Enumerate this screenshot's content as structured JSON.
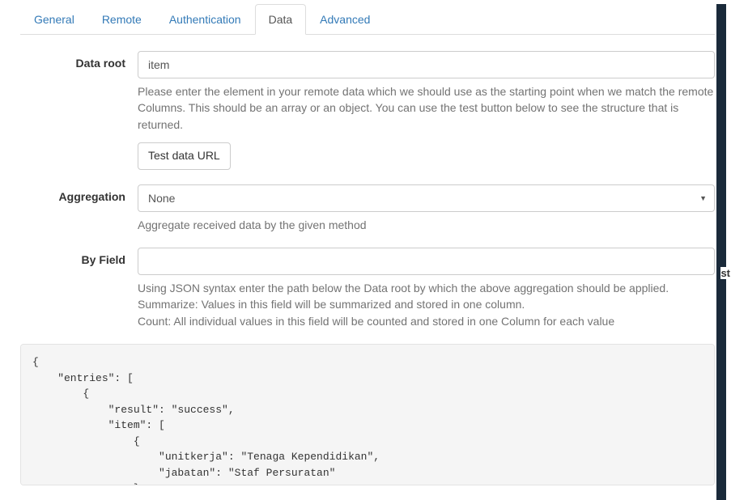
{
  "tabs": {
    "general": "General",
    "remote": "Remote",
    "authentication": "Authentication",
    "data": "Data",
    "advanced": "Advanced"
  },
  "form": {
    "dataRoot": {
      "label": "Data root",
      "value": "item",
      "help": "Please enter the element in your remote data which we should use as the starting point when we match the remote Columns. This should be an array or an object. You can use the test button below to see the structure that is returned.",
      "buttonLabel": "Test data URL"
    },
    "aggregation": {
      "label": "Aggregation",
      "value": "None",
      "help": "Aggregate received data by the given method"
    },
    "byField": {
      "label": "By Field",
      "value": "",
      "help": "Using JSON syntax enter the path below the Data root by which the above aggregation should be applied.\nSummarize: Values in this field will be summarized and stored in one column.\nCount: All individual values in this field will be counted and stored in one Column for each value"
    }
  },
  "codePreview": "{\n    \"entries\": [\n        {\n            \"result\": \"success\",\n            \"item\": [\n                {\n                    \"unitkerja\": \"Tenaga Kependidikan\",\n                    \"jabatan\": \"Staf Persuratan\"\n                },",
  "edgeText": "st"
}
